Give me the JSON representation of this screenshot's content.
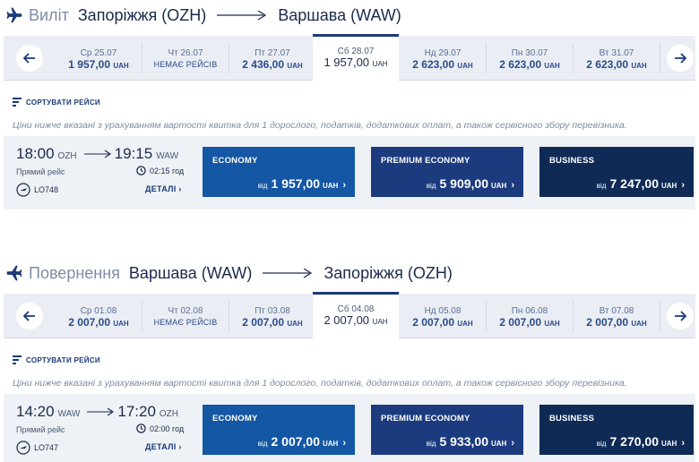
{
  "outbound": {
    "direction": "Виліт",
    "from": "Запоріжжя (OZH)",
    "to": "Варшава (WAW)",
    "dates": [
      {
        "day": "Ср 25.07",
        "price": "1 957,00",
        "cur": "UAH"
      },
      {
        "day": "Чт 26.07",
        "price": "НЕМАЄ РЕЙСІВ",
        "cur": ""
      },
      {
        "day": "Пт 27.07",
        "price": "2 436,00",
        "cur": "UAH"
      },
      {
        "day": "Сб 28.07",
        "price": "1 957,00",
        "cur": "UAH"
      },
      {
        "day": "Нд 29.07",
        "price": "2 623,00",
        "cur": "UAH"
      },
      {
        "day": "Пн 30.07",
        "price": "2 623,00",
        "cur": "UAH"
      },
      {
        "day": "Вт 31.07",
        "price": "2 623,00",
        "cur": "UAH"
      }
    ],
    "sort_label": "СОРТУВАТИ РЕЙСИ",
    "note": "Ціни нижче вказані з урахуванням вартості квитка для 1 дорослого, податків, додаткових оплат, а також сервісного збору перевізника.",
    "flight": {
      "dep_time": "18:00",
      "dep_code": "OZH",
      "arr_time": "19:15",
      "arr_code": "WAW",
      "type": "Прямий рейс",
      "duration": "02:15 год",
      "number": "LO748",
      "details": "ДЕТАЛІ"
    },
    "fares": [
      {
        "class": "ECONOMY",
        "from": "від",
        "amount": "1 957,00",
        "cur": "UAH"
      },
      {
        "class": "PREMIUM ECONOMY",
        "from": "від",
        "amount": "5 909,00",
        "cur": "UAH"
      },
      {
        "class": "BUSINESS",
        "from": "від",
        "amount": "7 247,00",
        "cur": "UAH"
      }
    ]
  },
  "return": {
    "direction": "Повернення",
    "from": "Варшава (WAW)",
    "to": "Запоріжжя (OZH)",
    "dates": [
      {
        "day": "Ср 01.08",
        "price": "2 007,00",
        "cur": "UAH"
      },
      {
        "day": "Чт 02.08",
        "price": "НЕМАЄ РЕЙСІВ",
        "cur": ""
      },
      {
        "day": "Пт 03.08",
        "price": "2 007,00",
        "cur": "UAH"
      },
      {
        "day": "Сб 04.08",
        "price": "2 007,00",
        "cur": "UAH"
      },
      {
        "day": "Нд 05.08",
        "price": "2 007,00",
        "cur": "UAH"
      },
      {
        "day": "Пн 06.08",
        "price": "2 007,00",
        "cur": "UAH"
      },
      {
        "day": "Вт 07.08",
        "price": "2 007,00",
        "cur": "UAH"
      }
    ],
    "sort_label": "СОРТУВАТИ РЕЙСИ",
    "note": "Ціни нижче вказані з урахуванням вартості квитка для 1 дорослого, податків, додаткових оплат, а також сервісного збору перевізника.",
    "flight": {
      "dep_time": "14:20",
      "dep_code": "WAW",
      "arr_time": "17:20",
      "arr_code": "OZH",
      "type": "Прямий рейс",
      "duration": "02:00 год",
      "number": "LO747",
      "details": "ДЕТАЛІ"
    },
    "fares": [
      {
        "class": "ECONOMY",
        "from": "від",
        "amount": "2 007,00",
        "cur": "UAH"
      },
      {
        "class": "PREMIUM ECONOMY",
        "from": "від",
        "amount": "5 933,00",
        "cur": "UAH"
      },
      {
        "class": "BUSINESS",
        "from": "від",
        "amount": "7 270,00",
        "cur": "UAH"
      }
    ]
  },
  "colors": {
    "economy": "#1457a4",
    "premium_economy": "#1c3b7f",
    "business": "#0f2a55",
    "accent": "#1b3a7a"
  }
}
